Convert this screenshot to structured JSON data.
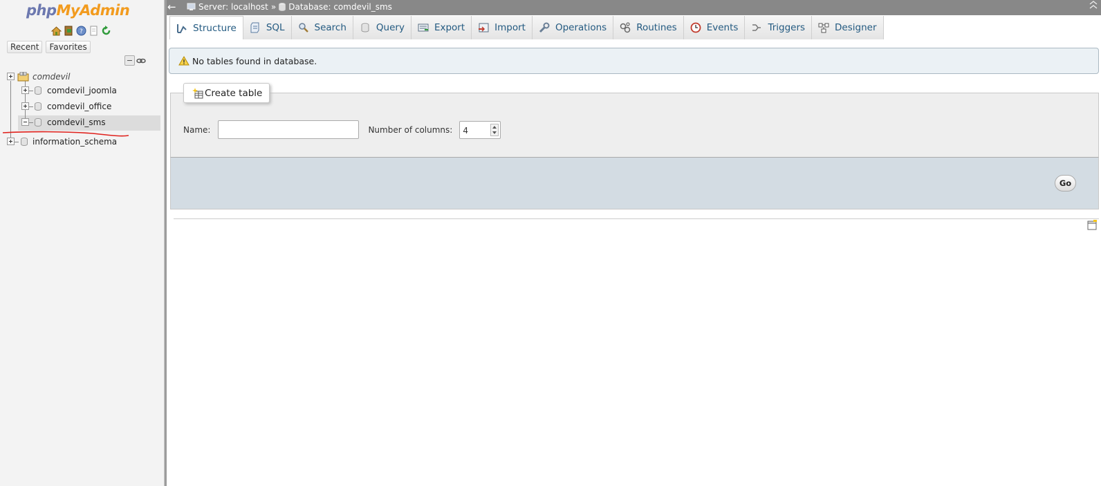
{
  "sidebar": {
    "logo_php": "php",
    "logo_myadmin": "MyAdmin",
    "quick_icons": [
      "home-icon",
      "exit-icon",
      "help-icon",
      "docs-icon",
      "reload-icon"
    ],
    "recent_label": "Recent",
    "favorites_label": "Favorites",
    "tree": {
      "server_group": "comdevil",
      "databases": [
        "comdevil_joomla",
        "comdevil_office",
        "comdevil_sms"
      ],
      "selected": "comdevil_sms",
      "other": "information_schema"
    }
  },
  "topbar": {
    "back_arrow": "←",
    "server_label": "Server: localhost",
    "separator": "»",
    "database_label": "Database: comdevil_sms"
  },
  "tabs": [
    {
      "label": "Structure",
      "icon": "structure-icon",
      "active": true
    },
    {
      "label": "SQL",
      "icon": "sql-icon"
    },
    {
      "label": "Search",
      "icon": "search-icon"
    },
    {
      "label": "Query",
      "icon": "query-icon"
    },
    {
      "label": "Export",
      "icon": "export-icon"
    },
    {
      "label": "Import",
      "icon": "import-icon"
    },
    {
      "label": "Operations",
      "icon": "operations-icon"
    },
    {
      "label": "Routines",
      "icon": "routines-icon"
    },
    {
      "label": "Events",
      "icon": "events-icon"
    },
    {
      "label": "Triggers",
      "icon": "triggers-icon"
    },
    {
      "label": "Designer",
      "icon": "designer-icon"
    }
  ],
  "notice": {
    "text": "No tables found in database.",
    "icon": "warning-icon"
  },
  "create_table": {
    "legend": "Create table",
    "name_label": "Name:",
    "name_value": "",
    "columns_label": "Number of columns:",
    "columns_value": "4",
    "go_label": "Go"
  },
  "colors": {
    "tab_text": "#235a81",
    "topbar_bg": "#888888",
    "notice_bg": "#ebf1f5",
    "footer_bg": "#d3dce3",
    "logo_php": "#6c78af",
    "logo_myadmin": "#f29b1e",
    "annotation_red": "#e0201b"
  }
}
